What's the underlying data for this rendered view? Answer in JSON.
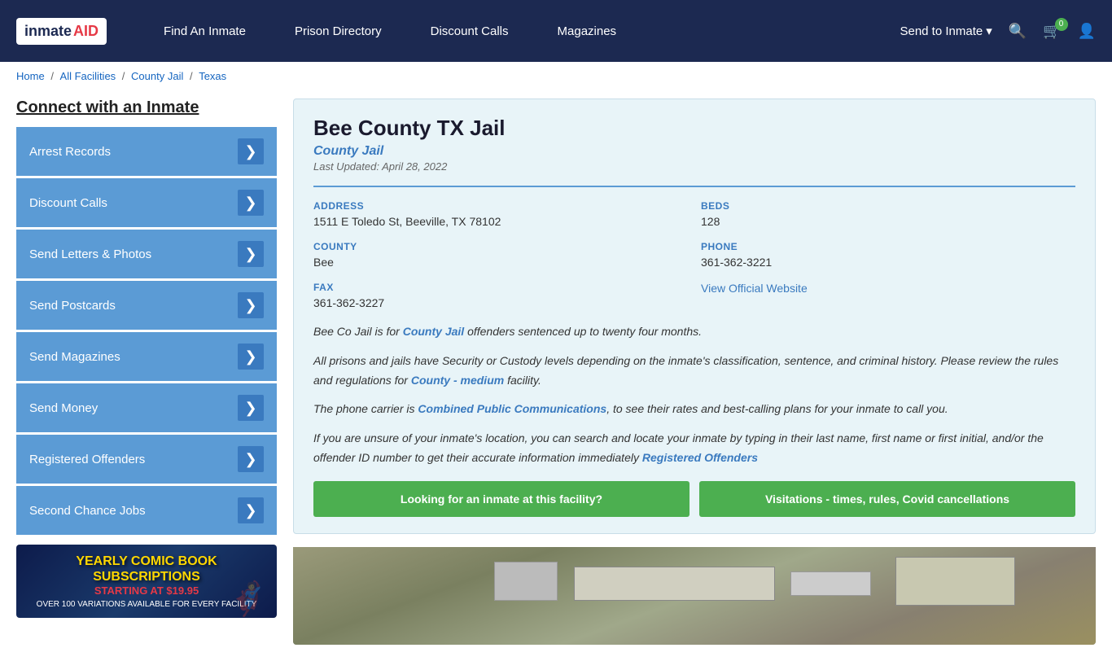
{
  "nav": {
    "logo": {
      "text_inmate": "inmate",
      "text_aid": "AID",
      "icon": "🎓"
    },
    "links": [
      {
        "label": "Find An Inmate",
        "id": "find-inmate"
      },
      {
        "label": "Prison Directory",
        "id": "prison-directory"
      },
      {
        "label": "Discount Calls",
        "id": "discount-calls"
      },
      {
        "label": "Magazines",
        "id": "magazines"
      }
    ],
    "send_label": "Send to Inmate",
    "send_arrow": "▾",
    "cart_count": "0",
    "search_icon": "🔍",
    "cart_icon": "🛒",
    "user_icon": "👤"
  },
  "breadcrumb": {
    "home": "Home",
    "all": "All Facilities",
    "type": "County Jail",
    "state": "Texas"
  },
  "sidebar": {
    "title": "Connect with an Inmate",
    "items": [
      {
        "label": "Arrest Records"
      },
      {
        "label": "Discount Calls"
      },
      {
        "label": "Send Letters & Photos"
      },
      {
        "label": "Send Postcards"
      },
      {
        "label": "Send Magazines"
      },
      {
        "label": "Send Money"
      },
      {
        "label": "Registered Offenders"
      },
      {
        "label": "Second Chance Jobs"
      }
    ],
    "ad": {
      "title": "YEARLY COMIC BOOK\nSUBSCRIPTIONS",
      "subtitle": "STARTING AT $19.95",
      "desc": "OVER 100 VARIATIONS AVAILABLE FOR EVERY FACILITY"
    }
  },
  "facility": {
    "name": "Bee County TX Jail",
    "type": "County Jail",
    "last_updated": "Last Updated: April 28, 2022",
    "address_label": "ADDRESS",
    "address_value": "1511 E Toledo St, Beeville, TX 78102",
    "beds_label": "BEDS",
    "beds_value": "128",
    "county_label": "COUNTY",
    "county_value": "Bee",
    "phone_label": "PHONE",
    "phone_value": "361-362-3221",
    "fax_label": "FAX",
    "fax_value": "361-362-3227",
    "website_label": "View Official Website",
    "desc1": "Bee Co Jail is for County Jail offenders sentenced up to twenty four months.",
    "desc1_link": "County Jail",
    "desc2": "All prisons and jails have Security or Custody levels depending on the inmate's classification, sentence, and criminal history. Please review the rules and regulations for County - medium facility.",
    "desc2_link": "County - medium",
    "desc3": "The phone carrier is Combined Public Communications, to see their rates and best-calling plans for your inmate to call you.",
    "desc3_link": "Combined Public Communications",
    "desc4": "If you are unsure of your inmate's location, you can search and locate your inmate by typing in their last name, first name or first initial, and/or the offender ID number to get their accurate information immediately Registered Offenders",
    "desc4_link": "Registered Offenders",
    "btn1": "Looking for an inmate at this facility?",
    "btn2": "Visitations - times, rules, Covid cancellations"
  }
}
